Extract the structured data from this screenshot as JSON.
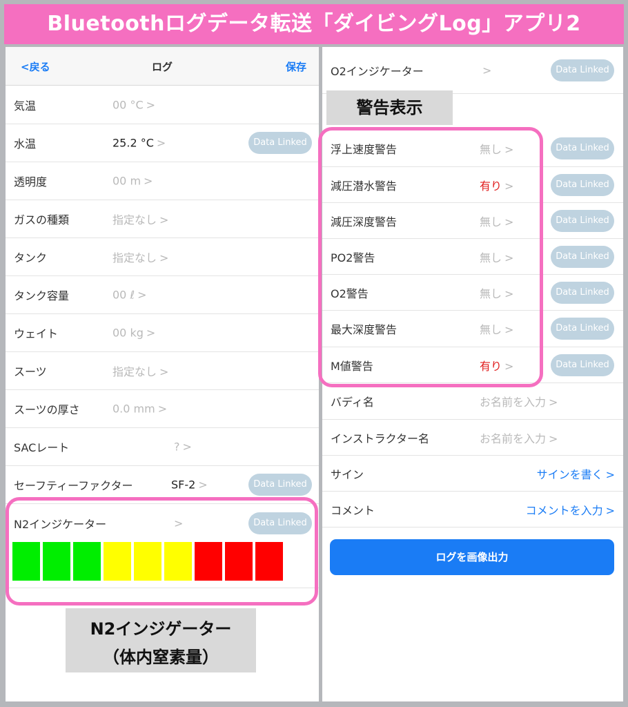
{
  "banner": {
    "title": "Bluetoothログデータ転送「ダイビングLog」アプリ2"
  },
  "nav": {
    "back": "<戻る",
    "title": "ログ",
    "save": "保存"
  },
  "chevron": ">",
  "pill_label": "Data Linked",
  "left_rows": [
    {
      "label": "気温",
      "value": "00 °C"
    },
    {
      "label": "水温",
      "value": "25.2 °C",
      "linked": true
    },
    {
      "label": "透明度",
      "value": "00 m"
    },
    {
      "label": "ガスの種類",
      "value": "指定なし"
    },
    {
      "label": "タンク",
      "value": "指定なし"
    },
    {
      "label": "タンク容量",
      "value": "00 ℓ"
    },
    {
      "label": "ウェイト",
      "value": "00 kg"
    },
    {
      "label": "スーツ",
      "value": "指定なし"
    },
    {
      "label": "スーツの厚さ",
      "value": "0.0 mm"
    },
    {
      "label": "SACレート",
      "value": "?"
    },
    {
      "label": "セーフティーファクター",
      "value": "SF-2",
      "linked": true
    },
    {
      "label": "N2インジケーター",
      "value": "",
      "linked": true
    }
  ],
  "n2_indicator": {
    "segments": [
      "#00ee00",
      "#00ee00",
      "#00ee00",
      "#ffff00",
      "#ffff00",
      "#ffff00",
      "#ff0000",
      "#ff0000",
      "#ff0000"
    ]
  },
  "right_top_row": {
    "label": "O2インジケーター",
    "value": "",
    "linked": true
  },
  "warnings": [
    {
      "label": "浮上速度警告",
      "value": "無し",
      "linked": true
    },
    {
      "label": "減圧潜水警告",
      "value": "有り",
      "linked": true
    },
    {
      "label": "減圧深度警告",
      "value": "無し",
      "linked": true
    },
    {
      "label": "PO2警告",
      "value": "無し",
      "linked": true
    },
    {
      "label": "O2警告",
      "value": "無し",
      "linked": true
    },
    {
      "label": "最大深度警告",
      "value": "無し",
      "linked": true
    },
    {
      "label": "M値警告",
      "value": "有り",
      "linked": true
    }
  ],
  "right_rows": [
    {
      "label": "バディ名",
      "value": "お名前を入力"
    },
    {
      "label": "インストラクター名",
      "value": "お名前を入力"
    },
    {
      "label": "サイン",
      "value": "サインを書く"
    },
    {
      "label": "コメント",
      "value": "コメントを入力"
    }
  ],
  "export_button": "ログを画像出力",
  "captions": {
    "warnings": "警告表示",
    "n2_line1": "N2インジゲーター",
    "n2_line2": "（体内窒素量）"
  },
  "colors": {
    "accent": "#1a7cf5",
    "highlight": "#f56fc0",
    "alert": "#e01e1e",
    "pill": "#bfd3e0"
  }
}
